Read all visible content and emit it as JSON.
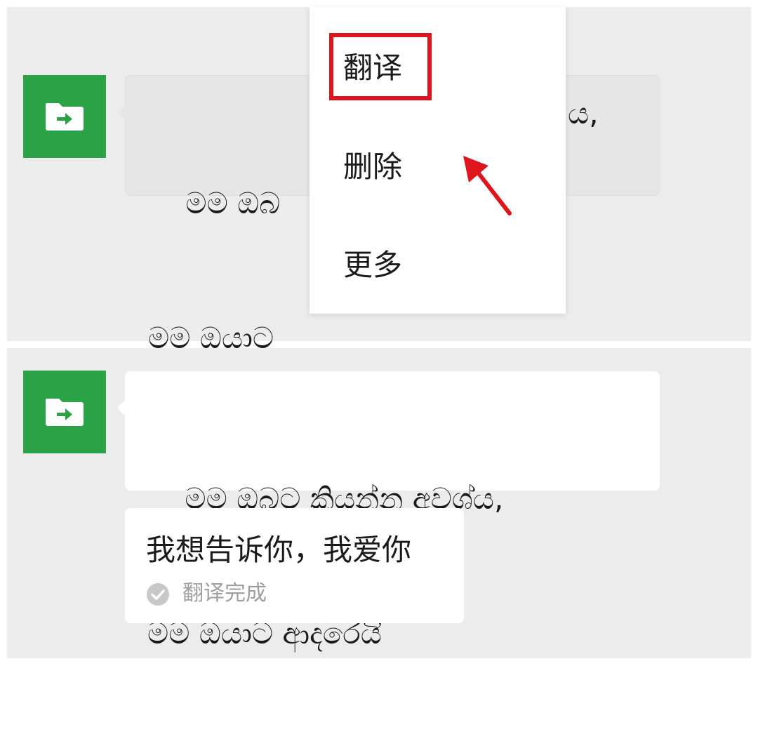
{
  "context_menu": {
    "items": [
      {
        "label": "翻译"
      },
      {
        "label": "删除"
      },
      {
        "label": "更多"
      }
    ],
    "highlighted_item": "翻译",
    "highlight_color": "#e0141c"
  },
  "message": {
    "line1": "    මම ඔබට කියන්න අවශ්ය,",
    "line2": "මම ඔයාට ආදරෙයි",
    "visible_fragments_top": {
      "line1_left": "    මම ඔබ",
      "line1_right": "ය,",
      "line2_left": "මම ඔයාට"
    },
    "avatar_icon": "file-transfer-icon",
    "avatar_color": "#2ba245"
  },
  "translation": {
    "text": "我想告诉你，我爱你",
    "status": "翻译完成",
    "status_icon": "check-circle-icon"
  }
}
